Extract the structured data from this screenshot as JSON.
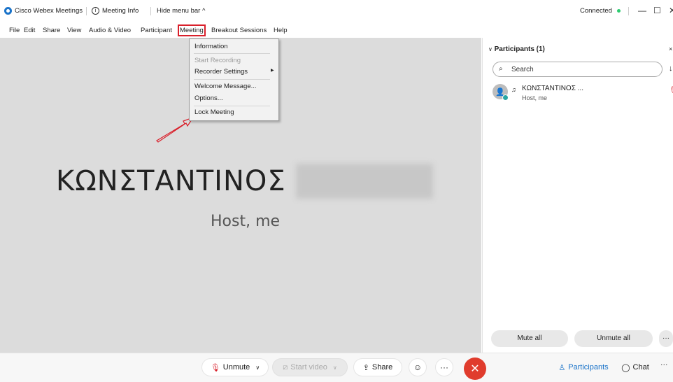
{
  "titlebar": {
    "app_name": "Cisco Webex Meetings",
    "meeting_info": "Meeting Info",
    "hide_menu_bar": "Hide menu bar ^",
    "status": "Connected",
    "status_color": "#2ecc71",
    "minimize": "—",
    "maximize": "☐",
    "close": "✕"
  },
  "menubar": {
    "items": [
      "File",
      "Edit",
      "Share",
      "View",
      "Audio & Video",
      "Participant",
      "Meeting",
      "Breakout Sessions",
      "Help"
    ],
    "active": "Meeting"
  },
  "meeting_menu": {
    "items": [
      {
        "label": "Information",
        "enabled": true
      },
      {
        "label": "Start Recording",
        "enabled": false
      },
      {
        "label": "Recorder Settings",
        "enabled": true,
        "submenu": true
      },
      {
        "label": "Welcome Message...",
        "enabled": true
      },
      {
        "label": "Options...",
        "enabled": true
      },
      {
        "label": "Lock Meeting",
        "enabled": true
      }
    ]
  },
  "stage": {
    "name": "ΚΩΝΣΤΑΝΤΙΝΟΣ",
    "role": "Host, me"
  },
  "participants_panel": {
    "title": "Participants (1)",
    "search_placeholder": "Search",
    "participants": [
      {
        "name": "ΚΩΝΣΤΑΝΤΙΝΟΣ ...",
        "role": "Host, me"
      }
    ],
    "mute_all": "Mute all",
    "unmute_all": "Unmute all",
    "more": "···"
  },
  "bottombar": {
    "unmute": "Unmute",
    "start_video": "Start video",
    "share": "Share",
    "more": "···",
    "participants": "Participants",
    "chat": "Chat",
    "overflow": "···",
    "leave_color": "#e03c2d",
    "accent": "#1a73c9"
  }
}
